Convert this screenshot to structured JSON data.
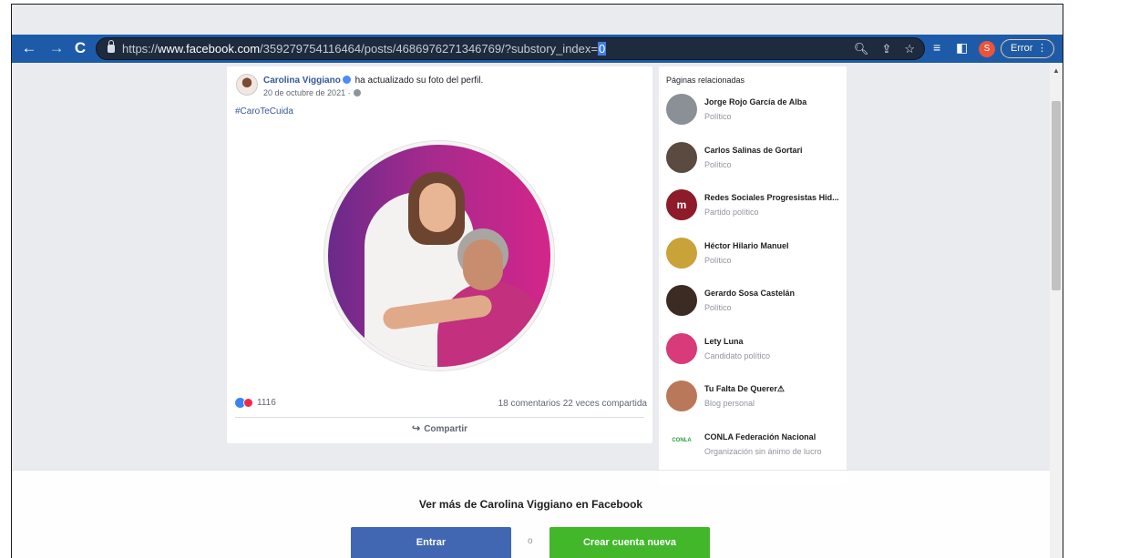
{
  "browser": {
    "url_prefix": "https://",
    "url_domain": "www.facebook.com",
    "url_path": "/359279754116464/posts/4686976271346769/?substory_index=",
    "url_selected": "0",
    "avatar_letter": "S",
    "error_label": "Error"
  },
  "post": {
    "author": "Carolina Viggiano",
    "action": "ha actualizado su foto del perfil.",
    "date": "20 de octubre de 2021 ·",
    "hashtag": "#CaroTeCuida",
    "reaction_count": "1116",
    "comments": "18 comentarios",
    "shares": "22 veces compartida",
    "share_label": "Compartir"
  },
  "related": {
    "title": "Páginas relacionadas",
    "items": [
      {
        "name": "Jorge Rojo García de Alba",
        "category": "Político",
        "color": "#8b8f96"
      },
      {
        "name": "Carlos Salinas de Gortari",
        "category": "Político",
        "color": "#5b4a40"
      },
      {
        "name": "Redes Sociales Progresistas Hid...",
        "category": "Partido político",
        "color": "#8d1b2a",
        "logo": "m"
      },
      {
        "name": "Héctor Hilario Manuel",
        "category": "Político",
        "color": "#c9a23a"
      },
      {
        "name": "Gerardo Sosa Castelán",
        "category": "Político",
        "color": "#3b2b22"
      },
      {
        "name": "Lety Luna",
        "category": "Candidato político",
        "color": "#d83a7a"
      },
      {
        "name": "Tu Falta De Querer⚠",
        "category": "Blog personal",
        "color": "#b9785a"
      },
      {
        "name": "CONLA Federación Nacional",
        "category": "Organización sin ánimo de lucro",
        "color": "#ffffff",
        "logo": "CONLA"
      }
    ]
  },
  "overlay": {
    "text": "Ver más de Carolina Viggiano en Facebook",
    "login": "Entrar",
    "or": "o",
    "create": "Crear cuenta nueva"
  }
}
